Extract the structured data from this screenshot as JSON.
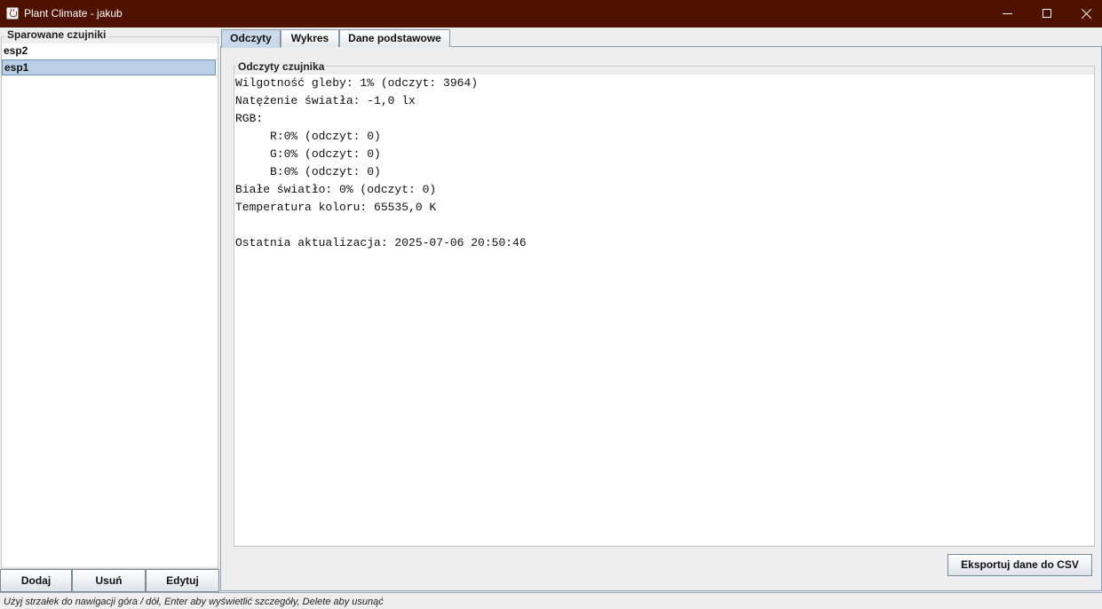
{
  "window": {
    "title": "Plant Climate - jakub",
    "icon": "java-cup-icon"
  },
  "sidebar": {
    "group_title": "Sparowane czujniki",
    "items": [
      {
        "label": "esp2",
        "selected": false
      },
      {
        "label": "esp1",
        "selected": true
      }
    ],
    "buttons": {
      "add": "Dodaj",
      "remove": "Usuń",
      "edit": "Edytuj"
    }
  },
  "tabs": [
    {
      "label": "Odczyty",
      "active": true
    },
    {
      "label": "Wykres",
      "active": false
    },
    {
      "label": "Dane podstawowe",
      "active": false
    }
  ],
  "readings": {
    "group_title": "Odczyty czujnika",
    "lines": [
      "Wilgotność gleby: 1% (odczyt: 3964)",
      "Natężenie światła: -1,0 lx",
      "RGB:",
      "     R:0% (odczyt: 0)",
      "     G:0% (odczyt: 0)",
      "     B:0% (odczyt: 0)",
      "Białe światło: 0% (odczyt: 0)",
      "Temperatura koloru: 65535,0 K",
      "",
      "Ostatnia aktualizacja: 2025-07-06 20:50:46"
    ]
  },
  "export_button": "Eksportuj dane do CSV",
  "status_bar": "Użyj strzałek do nawigacji góra / dół, Enter aby wyświetlić szczegóły, Delete aby usunąć",
  "colors": {
    "titlebar": "#4f1100",
    "selection": "#b8cfe5",
    "active_tab": "#c9d9ea"
  }
}
